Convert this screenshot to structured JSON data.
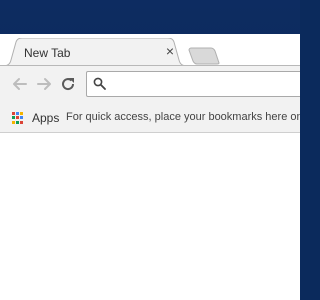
{
  "tab": {
    "title": "New Tab",
    "close_glyph": "×"
  },
  "omnibox": {
    "value": "",
    "placeholder": ""
  },
  "bookmarks": {
    "apps_label": "Apps",
    "hint": "For quick access, place your bookmarks here on the bookmarks bar."
  },
  "icons": {
    "back": "back-arrow-icon",
    "forward": "forward-arrow-icon",
    "reload": "reload-icon",
    "search": "search-icon",
    "apps": "apps-grid-icon",
    "close": "close-icon"
  },
  "colors": {
    "desktop": "#0b2a5c",
    "toolbar": "#f2f2f2",
    "apps_grid": [
      "#db4437",
      "#4285f4",
      "#f4b400",
      "#0f9d58",
      "#db4437",
      "#4285f4",
      "#f4b400",
      "#0f9d58",
      "#db4437"
    ]
  }
}
